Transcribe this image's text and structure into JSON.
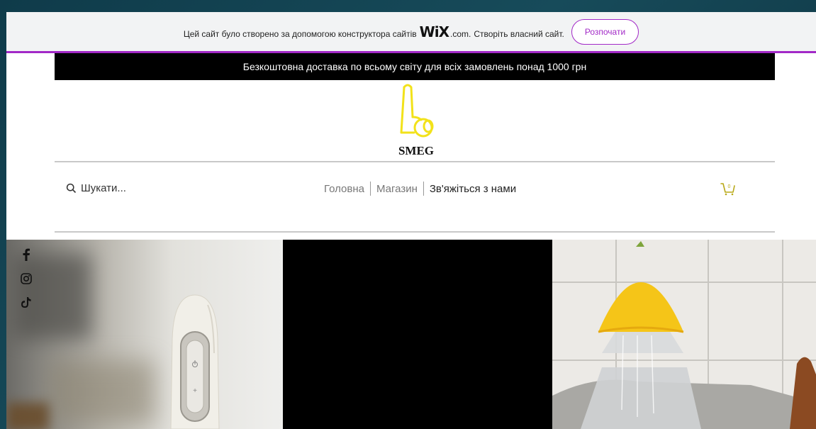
{
  "wix_banner": {
    "text_before": "Цей сайт було створено за допомогою конструктора сайтів",
    "logo": "WiX",
    "logo_suffix": ".com.",
    "text_after": "Створіть власний сайт.",
    "button_label": "Розпочати"
  },
  "promo_bar": {
    "text": "Безкоштовна доставка по всьому світу для всіх замовлень понад 1000 грн"
  },
  "brand": {
    "name": "SMEG",
    "logo_color": "#f2e21a"
  },
  "header": {
    "search_placeholder": "Шукати...",
    "nav": [
      {
        "label": "Головна"
      },
      {
        "label": "Магазин"
      },
      {
        "label": "Зв'яжіться з нами"
      }
    ],
    "cart_count": "0"
  },
  "social": {
    "icons": [
      "facebook-icon",
      "instagram-icon",
      "tiktok-icon"
    ]
  },
  "colors": {
    "wix_accent": "#a229c7",
    "promo_bg": "#000000",
    "lemon": "#f5c518"
  }
}
